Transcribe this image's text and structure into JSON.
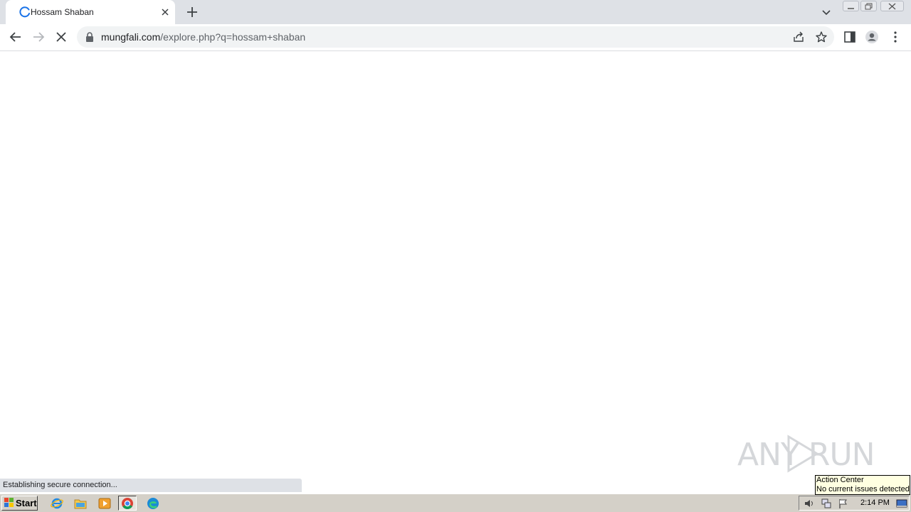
{
  "tab": {
    "title": "Hossam Shaban",
    "icon": "loading-spinner-icon"
  },
  "omnibox": {
    "host": "mungfali.com",
    "path": "/explore.php?q=hossam+shaban"
  },
  "status": {
    "text": "Establishing secure connection..."
  },
  "watermark": {
    "text": "ANY RUN"
  },
  "taskbar": {
    "start_label": "Start",
    "quick_launch": [
      "internet-explorer-icon",
      "file-explorer-icon",
      "media-player-icon",
      "chrome-icon",
      "edge-icon"
    ],
    "clock": "2:14 PM"
  },
  "tooltip": {
    "title": "Action Center",
    "body": "No current issues detected"
  },
  "colors": {
    "accent_blue": "#1a73e8",
    "tabstrip": "#dee1e6",
    "taskbar": "#d4d0c8"
  }
}
